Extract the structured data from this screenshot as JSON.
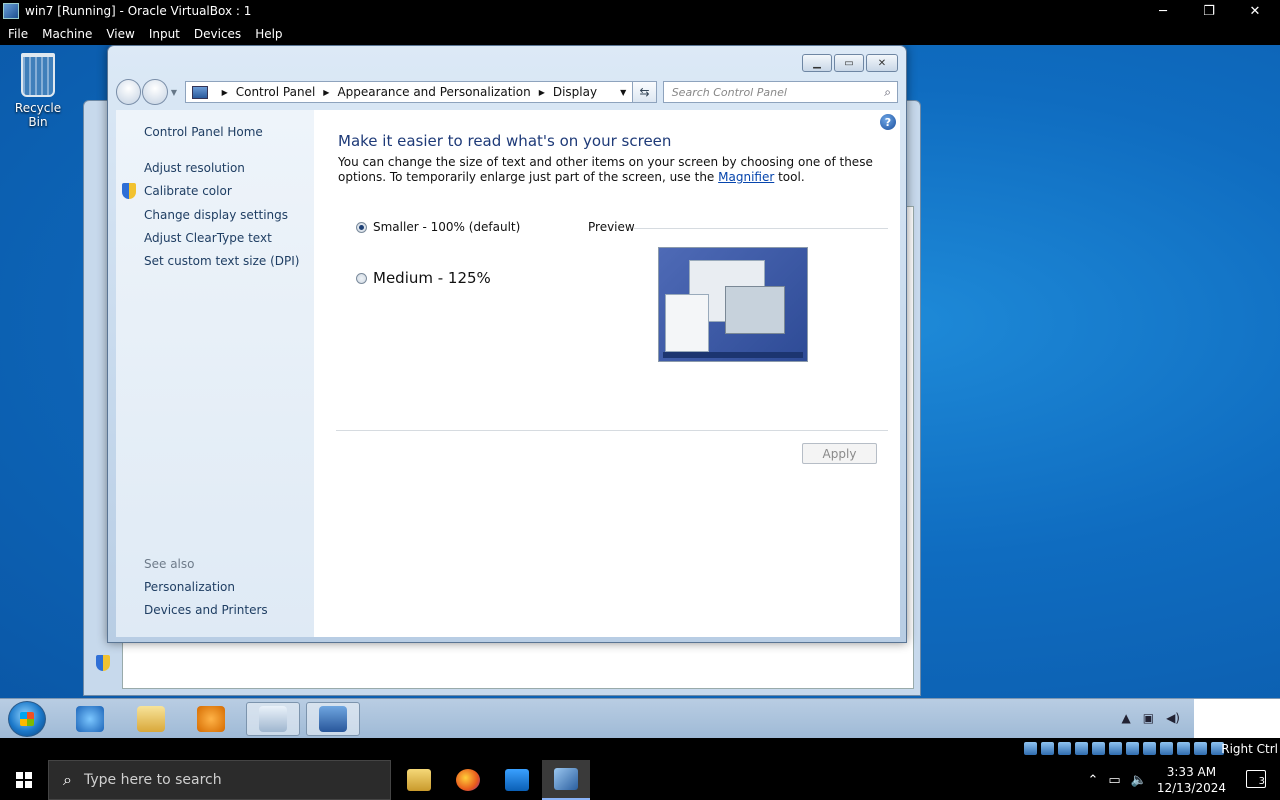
{
  "vbox": {
    "title": "win7 [Running] - Oracle VirtualBox : 1",
    "minimize": "─",
    "restore": "❐",
    "close": "✕",
    "menu": [
      "File",
      "Machine",
      "View",
      "Input",
      "Devices",
      "Help"
    ],
    "host_key": "Right Ctrl"
  },
  "desktop": {
    "recycle_bin": "Recycle Bin"
  },
  "window": {
    "breadcrumb": [
      "Control Panel",
      "Appearance and Personalization",
      "Display"
    ],
    "search_placeholder": "Search Control Panel",
    "left": {
      "home": "Control Panel Home",
      "tasks": [
        "Adjust resolution",
        "Calibrate color",
        "Change display settings",
        "Adjust ClearType text",
        "Set custom text size (DPI)"
      ],
      "see_also_title": "See also",
      "see_also": [
        "Personalization",
        "Devices and Printers"
      ]
    },
    "content": {
      "heading": "Make it easier to read what's on your screen",
      "desc_before": "You can change the size of text and other items on your screen by choosing one of these options. To temporarily enlarge just part of the screen, use the ",
      "desc_link": "Magnifier",
      "desc_after": " tool.",
      "options": [
        {
          "label": "Smaller - 100% (default)",
          "checked": true
        },
        {
          "label": "Medium - 125%",
          "checked": false
        }
      ],
      "preview_label": "Preview",
      "apply": "Apply",
      "help": "?"
    }
  },
  "host_taskbar": {
    "search_placeholder": "Type here to search",
    "time": "3:33 AM",
    "date": "12/13/2024",
    "notifications": "3"
  }
}
